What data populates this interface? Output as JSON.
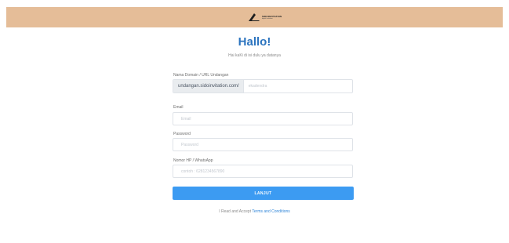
{
  "header": {
    "logo_line1": "SIDOINVITATION",
    "logo_line2": "digital invitation"
  },
  "heading": {
    "title": "Hallo!",
    "subtitle": "Hai kaKi di isi dulu ya datanya"
  },
  "form": {
    "domain": {
      "label": "Nama Domain / URL Undangan",
      "prefix": "undangan.sidoinvitation.com/",
      "placeholder": "ekadendra"
    },
    "email": {
      "label": "Email",
      "placeholder": "Email"
    },
    "password": {
      "label": "Password",
      "placeholder": "Password"
    },
    "phone": {
      "label": "Nomor HP / WhatsApp",
      "placeholder": "contoh : 6281234567890"
    },
    "submit_label": "LANJUT"
  },
  "terms": {
    "prefix": "I Read and Accept",
    "link": "Terms and Conditions"
  },
  "colors": {
    "topbar": "#e5bd98",
    "title": "#2c74bf",
    "button": "#3c9bf2",
    "link": "#2f85d8"
  }
}
